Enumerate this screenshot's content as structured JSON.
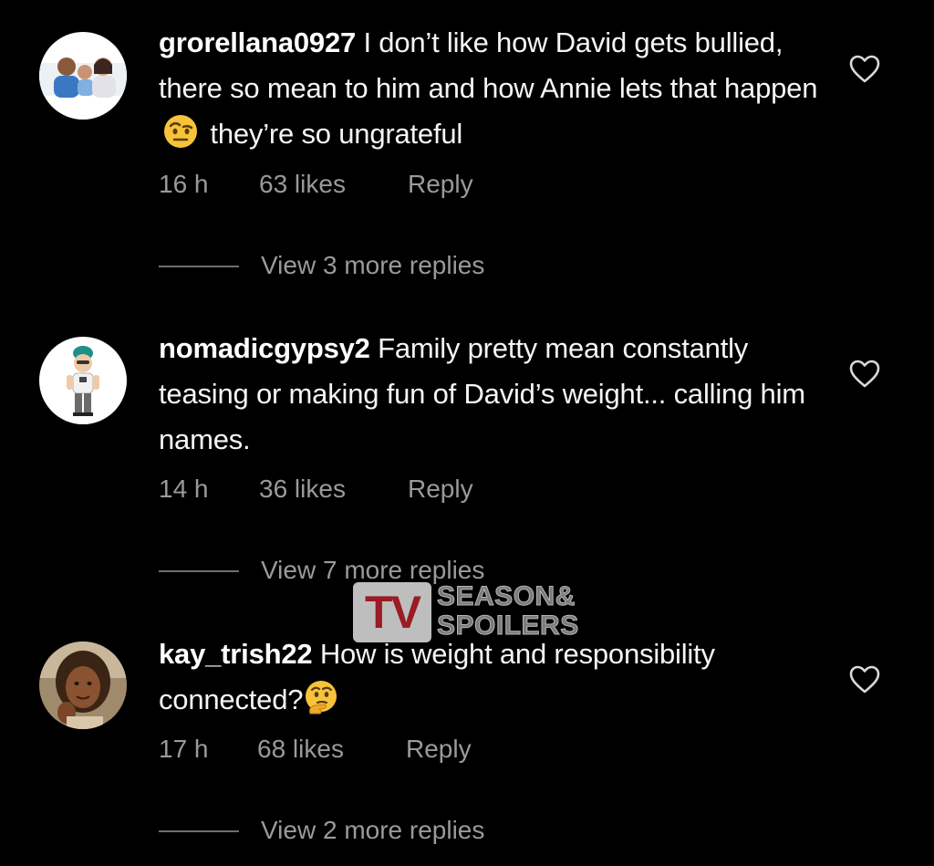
{
  "comments": [
    {
      "username": "grorellana0927",
      "text_part1": "I don’t like how David gets bullied, there so mean to him and how Annie lets that happen",
      "emoji": "raised-eyebrow-emoji",
      "text_part2": "they’re so ungrateful",
      "time": "16 h",
      "likes": "63 likes",
      "reply_label": "Reply",
      "view_replies": "View 3 more replies"
    },
    {
      "username": "nomadicgypsy2",
      "text_part1": "Family pretty mean constantly teasing or making fun of David’s weight... calling him names.",
      "time": "14 h",
      "likes": "36 likes",
      "reply_label": "Reply",
      "view_replies": "View 7 more replies"
    },
    {
      "username": "kay_trish22",
      "text_part1": "How is weight and responsibility connected?",
      "emoji": "thinking-face-emoji",
      "time": "17 h",
      "likes": "68 likes",
      "reply_label": "Reply",
      "view_replies": "View 2 more replies"
    }
  ],
  "watermark": {
    "logo_mark": "TV",
    "line1": "SEASON&",
    "line2": "SPOILERS"
  },
  "colors": {
    "background": "#000000",
    "text_primary": "#f5f5f5",
    "text_secondary": "#9a9a9a"
  },
  "icons": {
    "like": "heart-outline-icon"
  }
}
